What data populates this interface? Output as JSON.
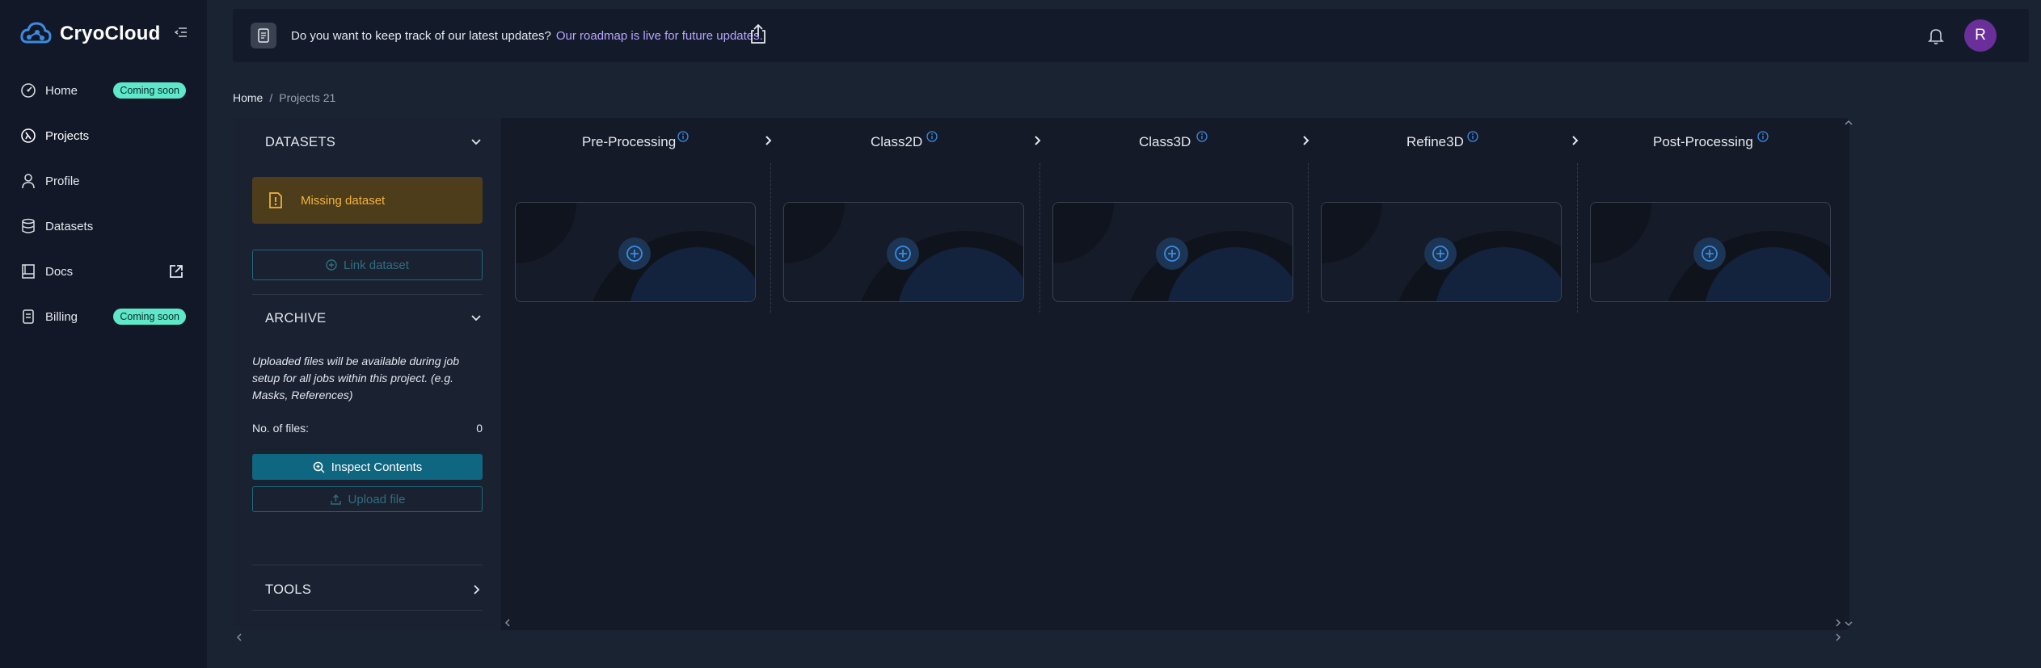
{
  "brand": {
    "name": "CryoCloud"
  },
  "sidebar": {
    "items": [
      {
        "label": "Home",
        "badge": "Coming soon"
      },
      {
        "label": "Projects"
      },
      {
        "label": "Profile"
      },
      {
        "label": "Datasets"
      },
      {
        "label": "Docs"
      },
      {
        "label": "Billing",
        "badge": "Coming soon"
      }
    ]
  },
  "banner": {
    "text": "Do you want to keep track of our latest updates?",
    "link": "Our roadmap is live for future updates."
  },
  "user": {
    "avatar_initial": "R"
  },
  "breadcrumb": {
    "home": "Home",
    "separator": "/",
    "current": "Projects 21"
  },
  "datasets": {
    "title": "DATASETS",
    "missing": "Missing dataset",
    "link_button": "Link dataset"
  },
  "archive": {
    "title": "ARCHIVE",
    "description": "Uploaded files will be available during job setup for all jobs within this project. (e.g. Masks, References)",
    "files_label": "No. of files:",
    "files_count": "0",
    "inspect_button": "Inspect Contents",
    "upload_button": "Upload file"
  },
  "tools": {
    "title": "TOOLS"
  },
  "stages": [
    {
      "title": "Pre-Processing"
    },
    {
      "title": "Class2D"
    },
    {
      "title": "Class3D"
    },
    {
      "title": "Refine3D"
    },
    {
      "title": "Post-Processing"
    }
  ],
  "colors": {
    "badge": "#5ee7c9",
    "accent": "#0f6680",
    "warning": "#f2b43a",
    "link": "#b9a5ff",
    "avatar": "#6a2f9a"
  }
}
